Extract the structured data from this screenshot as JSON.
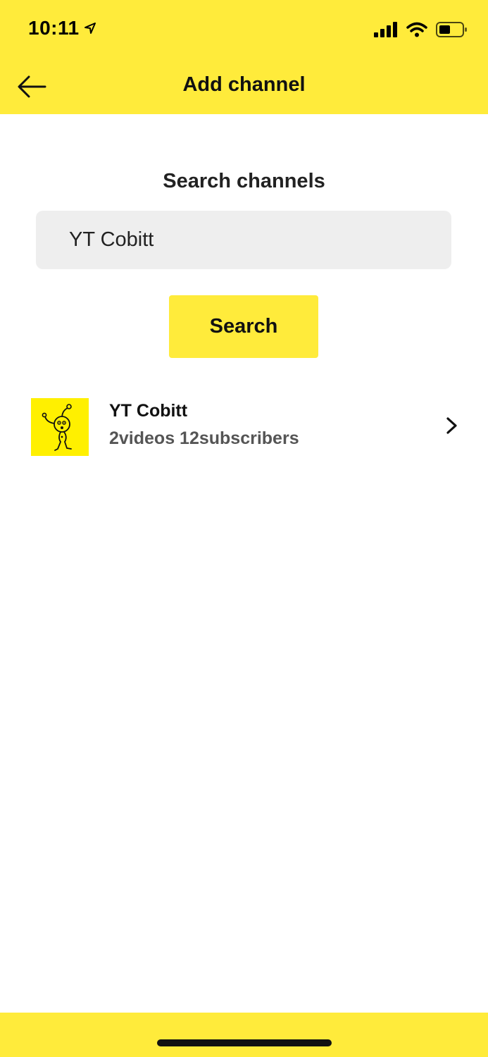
{
  "status_bar": {
    "time": "10:11",
    "icons": [
      "location-arrow-icon",
      "cellular-signal-icon",
      "wifi-icon",
      "battery-icon"
    ]
  },
  "header": {
    "title": "Add channel",
    "back_icon": "back-arrow-icon",
    "background_color": "#FFEB3B"
  },
  "search": {
    "section_title": "Search channels",
    "input_value": "YT Cobitt",
    "button_label": "Search"
  },
  "results": [
    {
      "name": "YT Cobitt",
      "meta": "2videos 12subscribers",
      "avatar_icon": "channel-avatar-icon",
      "chevron_icon": "chevron-right-icon"
    }
  ],
  "colors": {
    "accent": "#FFEB3B",
    "input_bg": "#EEEEEE",
    "secondary_text": "#555555"
  }
}
